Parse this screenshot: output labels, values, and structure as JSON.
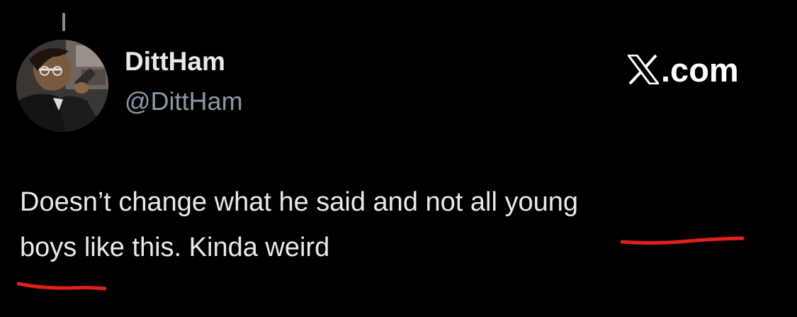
{
  "thread_indicator": "thread-connector",
  "author": {
    "display_name": "DittHam",
    "handle": "@DittHam",
    "avatar_icon": "anime-character-avatar"
  },
  "brand": {
    "logo_icon": "x-logo-icon",
    "text": ".com"
  },
  "tweet": {
    "lines": [
      "Doesn’t change what he said and not all young",
      "boys like this. Kinda weird"
    ]
  },
  "annotations": {
    "color": "#e0201b",
    "underlined_words": [
      "young",
      "boys"
    ]
  },
  "colors": {
    "background": "#000000",
    "text_primary": "#e7e9ea",
    "text_secondary": "#8b98a5"
  }
}
